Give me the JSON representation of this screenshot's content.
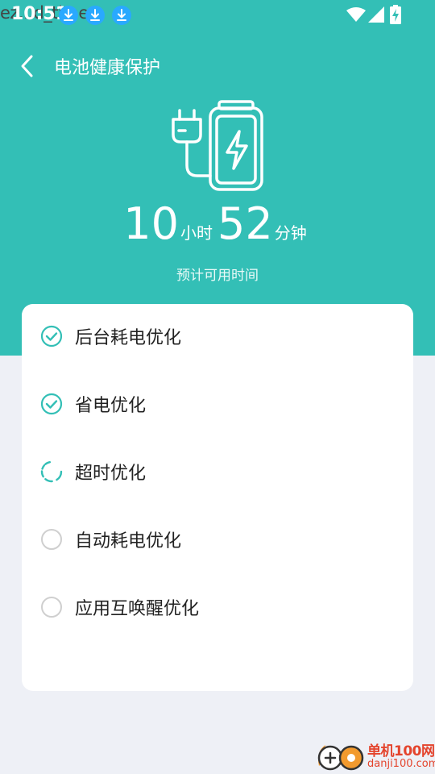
{
  "status_bar": {
    "time": "10:51",
    "overlay_text": "ez...d_time",
    "download_icons": [
      "download-icon",
      "download-icon",
      "download-icon"
    ],
    "right_icons": [
      "wifi-icon",
      "signal-icon",
      "battery-charging-icon"
    ]
  },
  "header": {
    "title": "电池健康保护",
    "back_icon": "back-arrow-icon",
    "illustration_icon": "battery-plug-icon"
  },
  "battery": {
    "hours": "10",
    "hours_unit": "小时",
    "minutes": "52",
    "minutes_unit": "分钟",
    "label": "预计可用时间"
  },
  "optimizations": [
    {
      "label": "后台耗电优化",
      "status": "done"
    },
    {
      "label": "省电优化",
      "status": "done"
    },
    {
      "label": "超时优化",
      "status": "in-progress"
    },
    {
      "label": "自动耗电优化",
      "status": "pending"
    },
    {
      "label": "应用互唤醒优化",
      "status": "pending"
    }
  ],
  "watermark": {
    "title": "单机100网",
    "url": "danji100.com"
  },
  "colors": {
    "accent": "#33bfb6",
    "background": "#eef0f6",
    "card": "#ffffff",
    "watermark": "#e4442d"
  }
}
